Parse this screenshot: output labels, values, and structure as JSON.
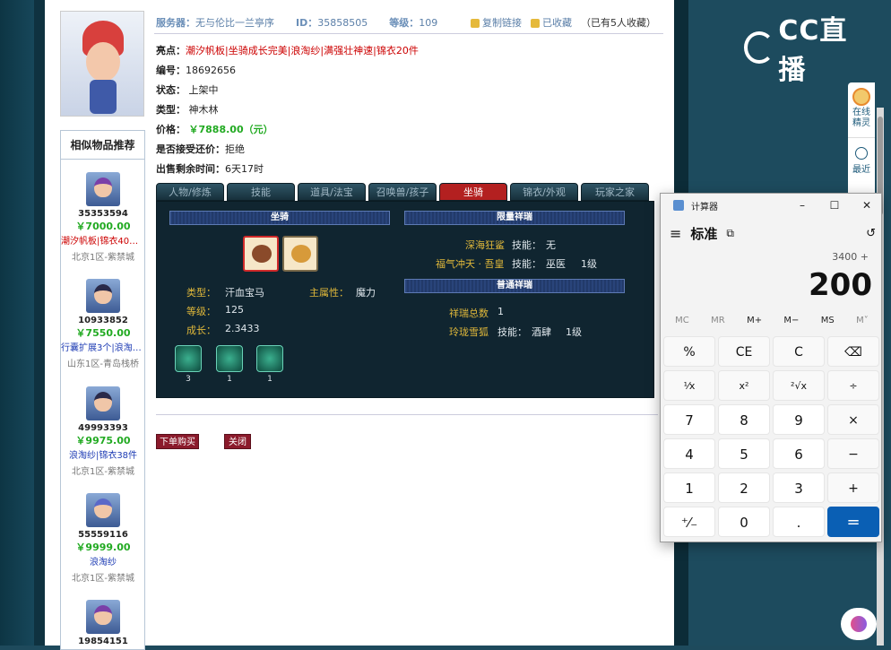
{
  "brand": {
    "name": "CC直播"
  },
  "sidetab": {
    "label1": "在线精灵",
    "label2": "最近"
  },
  "top": {
    "server_label": "服务器：",
    "server": "无与伦比一兰亭序",
    "id_label": "ID：",
    "id": "35858505",
    "level_label": "等级：",
    "level": "109",
    "copy_link": "复制链接",
    "favorited": "已收藏",
    "fav_count": "（已有5人收藏）"
  },
  "info": {
    "highlight_label": "亮点：",
    "highlight": "潮汐帆板|坐骑成长完美|浪淘纱|满强壮神速|锦衣20件",
    "serial_label": "编号：",
    "serial": "18692656",
    "status_label": "状态：",
    "status": "上架中",
    "type_label": "类型：",
    "type": "神木林",
    "price_label": "价格：",
    "price": "￥7888.00（元）",
    "bargain_label": "是否接受还价：",
    "bargain": "拒绝",
    "remain_label": "出售剩余时间：",
    "remain": "6天17时"
  },
  "tabs": [
    "人物/修炼",
    "技能",
    "道具/法宝",
    "召唤兽/孩子",
    "坐骑",
    "锦衣/外观",
    "玩家之家"
  ],
  "active_tab": "坐骑",
  "mount": {
    "header": "坐骑",
    "type_label": "类型：",
    "type": "汗血宝马",
    "main_label": "主属性：",
    "main": "魔力",
    "level_label": "等级：",
    "level": "125",
    "growth_label": "成长：",
    "growth": "2.3433",
    "skills": [
      "3",
      "1",
      "1"
    ]
  },
  "limited": {
    "header": "限量祥瑞",
    "rows": [
      {
        "name": "深海狂鲨",
        "skill_label": "技能：",
        "skill": "无",
        "lvl": ""
      },
      {
        "name": "福气冲天 · 吾皇",
        "skill_label": "技能：",
        "skill": "巫医",
        "lvl": "1级"
      }
    ]
  },
  "normal": {
    "header": "普通祥瑞",
    "total_label": "祥瑞总数",
    "total": "1",
    "row": {
      "name": "玲珑雪狐",
      "skill_label": "技能：",
      "skill": "酒肆",
      "lvl": "1级"
    }
  },
  "buttons": {
    "buy": "下单购买",
    "close": "关闭"
  },
  "sidebar": {
    "title": "相似物品推荐",
    "items": [
      {
        "id": "35353594",
        "price": "￥7000.00",
        "tags": "潮汐帆板|锦衣40件|…",
        "tags_color": "red",
        "server": "北京1区-紫禁城"
      },
      {
        "id": "10933852",
        "price": "￥7550.00",
        "tags": "行囊扩展3个|浪淘纱…",
        "tags_color": "blue",
        "server": "山东1区-青岛栈桥"
      },
      {
        "id": "49993393",
        "price": "￥9975.00",
        "tags": "浪淘纱|锦衣38件",
        "tags_color": "blue",
        "server": "北京1区-紫禁城"
      },
      {
        "id": "55559116",
        "price": "￥9999.00",
        "tags": "浪淘纱",
        "tags_color": "blue",
        "server": "北京1区-紫禁城"
      },
      {
        "id": "19854151",
        "price": "",
        "tags": "",
        "tags_color": "blue",
        "server": ""
      }
    ]
  },
  "calc": {
    "title": "计算器",
    "mode": "标准",
    "expr": "3400 +",
    "display": "200",
    "mem": [
      "MC",
      "MR",
      "M+",
      "M−",
      "MS",
      "M˅"
    ],
    "keys": [
      "%",
      "CE",
      "C",
      "⌫",
      "¹⁄x",
      "x²",
      "²√x",
      "÷",
      "7",
      "8",
      "9",
      "×",
      "4",
      "5",
      "6",
      "−",
      "1",
      "2",
      "3",
      "+",
      "⁺⁄₋",
      "0",
      ".",
      "="
    ]
  }
}
